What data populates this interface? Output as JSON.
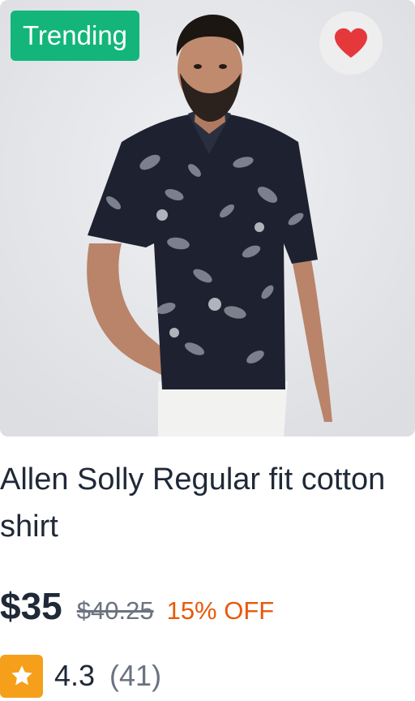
{
  "product": {
    "badge": "Trending",
    "title": "Allen Solly Regular fit cotton shirt",
    "price": "$35",
    "original_price": "$40.25",
    "discount": "15% OFF",
    "rating": "4.3",
    "review_count": "(41)",
    "favorite_icon": "heart-icon",
    "rating_icon": "star-icon",
    "image_description_icon": "product-photo"
  },
  "colors": {
    "badge_bg": "#13b57b",
    "heart": "#e5383b",
    "discount": "#e8590c",
    "star_bg": "#f59f1a",
    "text": "#1f2937",
    "muted": "#6b7280"
  }
}
